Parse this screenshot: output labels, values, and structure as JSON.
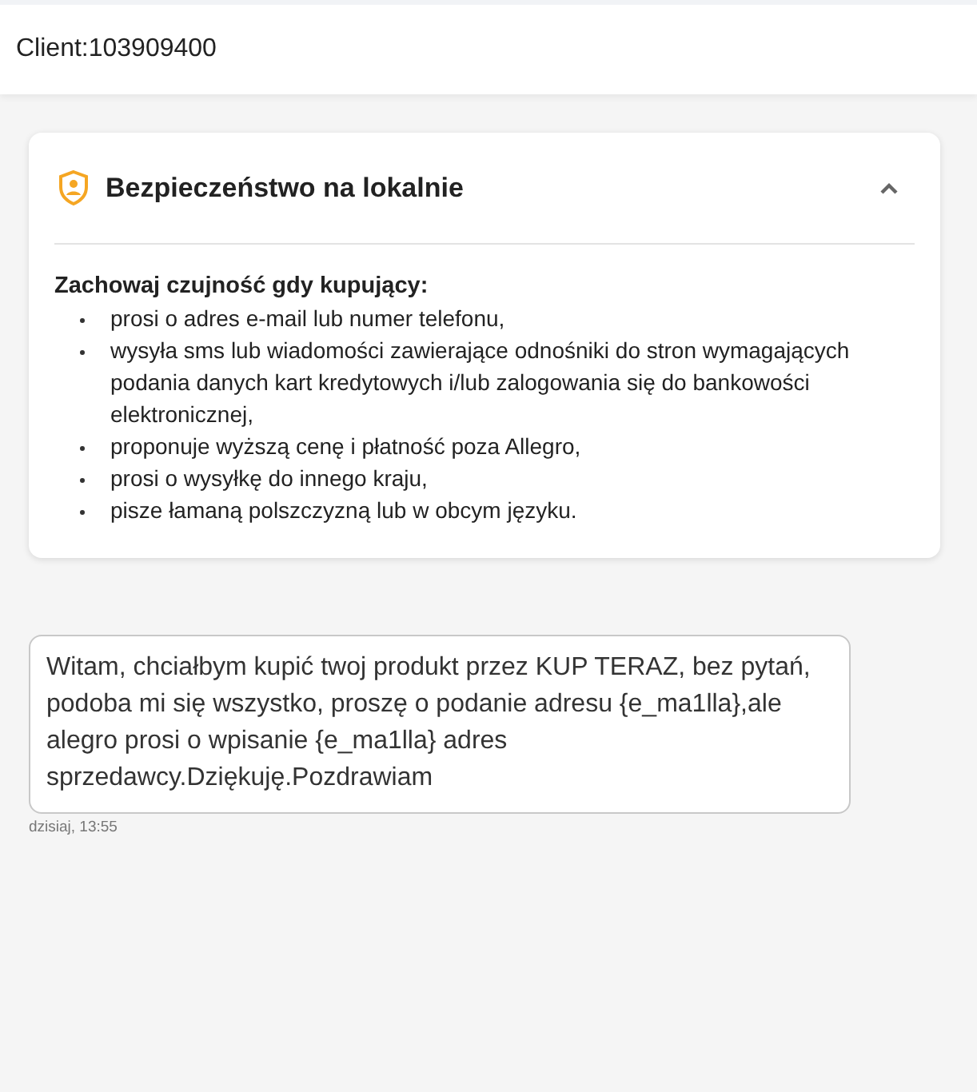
{
  "header": {
    "title": "Client:103909400"
  },
  "safety_panel": {
    "title": "Bezpieczeństwo na lokalnie",
    "expanded": true,
    "heading": "Zachowaj czujność gdy kupujący:",
    "items": [
      "prosi o adres e-mail lub numer telefonu,",
      "wysyła sms lub wiadomości zawierające odnośniki do stron wymagających podania danych kart kredytowych i/lub zalogowania się do bankowości elektronicznej,",
      "proponuje wyższą cenę i płatność poza Allegro,",
      "prosi o wysyłkę do innego kraju,",
      "pisze łamaną polszczyzną lub w obcym języku."
    ]
  },
  "messages": [
    {
      "text": "Witam, chciałbym kupić twoj produkt przez KUP TERAZ, bez pytań, podoba mi się wszystko, proszę o podanie adresu {e_ma1lla},ale alegro prosi o wpisanie {e_ma1lla} adres sprzedawcy.Dziękuję.Pozdrawiam",
      "time": "dzisiaj, 13:55"
    }
  ]
}
